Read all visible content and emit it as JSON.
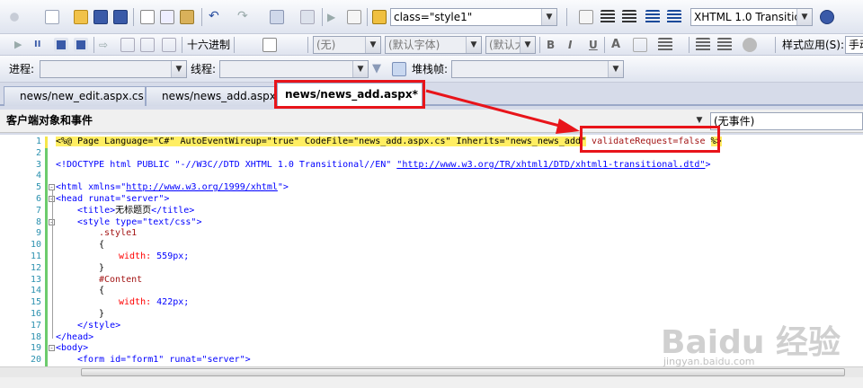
{
  "toolbar1": {
    "class_combo": "class=\"style1\"",
    "doctype_combo": "XHTML 1.0 Transitic",
    "colors": {
      "accent": "#316ac5",
      "arrow": "#e8141a"
    }
  },
  "toolbar2": {
    "hex_label": "十六进制",
    "style_combo": "(无)",
    "font_combo": "(默认字体)",
    "size_combo": "(默认大",
    "bold": "B",
    "italic": "I",
    "underline": "U",
    "style_apply_label": "样式应用(S):",
    "style_apply_value": "手动"
  },
  "toolbar3": {
    "process_label": "进程:",
    "thread_label": "线程:",
    "stackframe_label": "堆栈帧:"
  },
  "tabs": [
    {
      "label": "news/new_edit.aspx.cs"
    },
    {
      "label": "news/news_add.aspx.cs"
    },
    {
      "label": "news/news_add.aspx*"
    }
  ],
  "object_bar": {
    "left": "客户端对象和事件",
    "right": "(无事件)"
  },
  "editor": {
    "line_numbers": [
      "1",
      "2",
      "3",
      "4",
      "5",
      "6",
      "7",
      "8",
      "9",
      "10",
      "11",
      "12",
      "13",
      "14",
      "15",
      "16",
      "17",
      "18",
      "19",
      "20"
    ],
    "l1_a": "<%@ Page Language=\"C#\" AutoEventWireup=\"true\" CodeFile=\"news_add.aspx.cs\" Inherits=\"news_news_add\"",
    "l1_b": "validateRequest=false",
    "l1_c": "%>",
    "l3_a": "<!DOCTYPE html PUBLIC \"-//W3C//DTD XHTML 1.0 Transitional//EN\" ",
    "l3_b": "\"http://www.w3.org/TR/xhtml1/DTD/xhtml1-transitional.dtd\"",
    "l3_c": ">",
    "l5_a": "<html xmlns=\"",
    "l5_b": "http://www.w3.org/1999/xhtml",
    "l5_c": "\">",
    "l6": "<head runat=\"server\">",
    "l7_a": "<title>",
    "l7_b": "无标题页",
    "l7_c": "</title>",
    "l8": "<style type=\"text/css\">",
    "l9": ".style1",
    "l10": "{",
    "l11_a": "width: ",
    "l11_b": "559px;",
    "l12": "}",
    "l13": "#Content",
    "l14": "{",
    "l15_a": "width: ",
    "l15_b": "422px;",
    "l16": "}",
    "l17": "</style>",
    "l18": "</head>",
    "l19": "<body>",
    "l20": "<form id=\"form1\" runat=\"server\">"
  },
  "watermark": {
    "main": "Baidu 经验",
    "sub": "jingyan.baidu.com"
  }
}
